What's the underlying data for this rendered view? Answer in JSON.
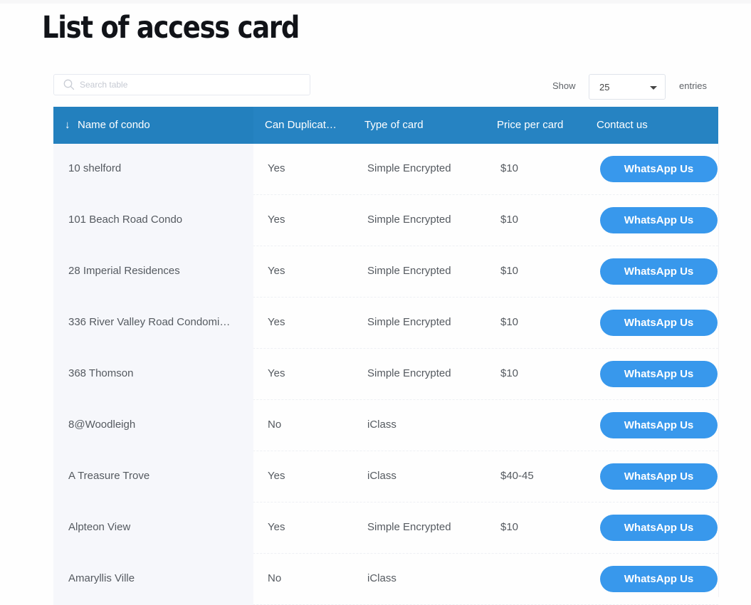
{
  "page": {
    "title": "List of access card"
  },
  "search": {
    "placeholder": "Search table",
    "value": ""
  },
  "entries": {
    "show_label": "Show",
    "selected": "25",
    "suffix_label": "entries"
  },
  "table": {
    "sort_icon": "arrow-down",
    "columns": [
      {
        "label": "Name of condo",
        "sorted": "descending"
      },
      {
        "label": "Can Duplicat…"
      },
      {
        "label": "Type of card"
      },
      {
        "label": "Price per card"
      },
      {
        "label": "Contact us"
      }
    ],
    "rows": [
      {
        "name": "10 shelford",
        "can_duplicate": "Yes",
        "type": "Simple Encrypted",
        "price": "$10",
        "action": "WhatsApp Us"
      },
      {
        "name": "101 Beach Road Condo",
        "can_duplicate": "Yes",
        "type": "Simple Encrypted",
        "price": "$10",
        "action": "WhatsApp Us"
      },
      {
        "name": "28 Imperial Residences",
        "can_duplicate": "Yes",
        "type": "Simple Encrypted",
        "price": "$10",
        "action": "WhatsApp Us"
      },
      {
        "name": "336 River Valley Road Condomi…",
        "can_duplicate": "Yes",
        "type": "Simple Encrypted",
        "price": "$10",
        "action": "WhatsApp Us"
      },
      {
        "name": "368 Thomson",
        "can_duplicate": "Yes",
        "type": "Simple Encrypted",
        "price": "$10",
        "action": "WhatsApp Us"
      },
      {
        "name": "8@Woodleigh",
        "can_duplicate": "No",
        "type": "iClass",
        "price": "",
        "action": "WhatsApp Us"
      },
      {
        "name": "A Treasure Trove",
        "can_duplicate": "Yes",
        "type": "iClass",
        "price": "$40-45",
        "action": "WhatsApp Us"
      },
      {
        "name": "Alpteon View",
        "can_duplicate": "Yes",
        "type": "Simple Encrypted",
        "price": "$10",
        "action": "WhatsApp Us"
      },
      {
        "name": "Amaryllis Ville",
        "can_duplicate": "No",
        "type": "iClass",
        "price": "",
        "action": "WhatsApp Us"
      }
    ]
  },
  "colors": {
    "header_bg": "#2683c2",
    "button_bg": "#3898ec",
    "first_col_bg": "#f6f7fb",
    "title_text": "#111318"
  }
}
